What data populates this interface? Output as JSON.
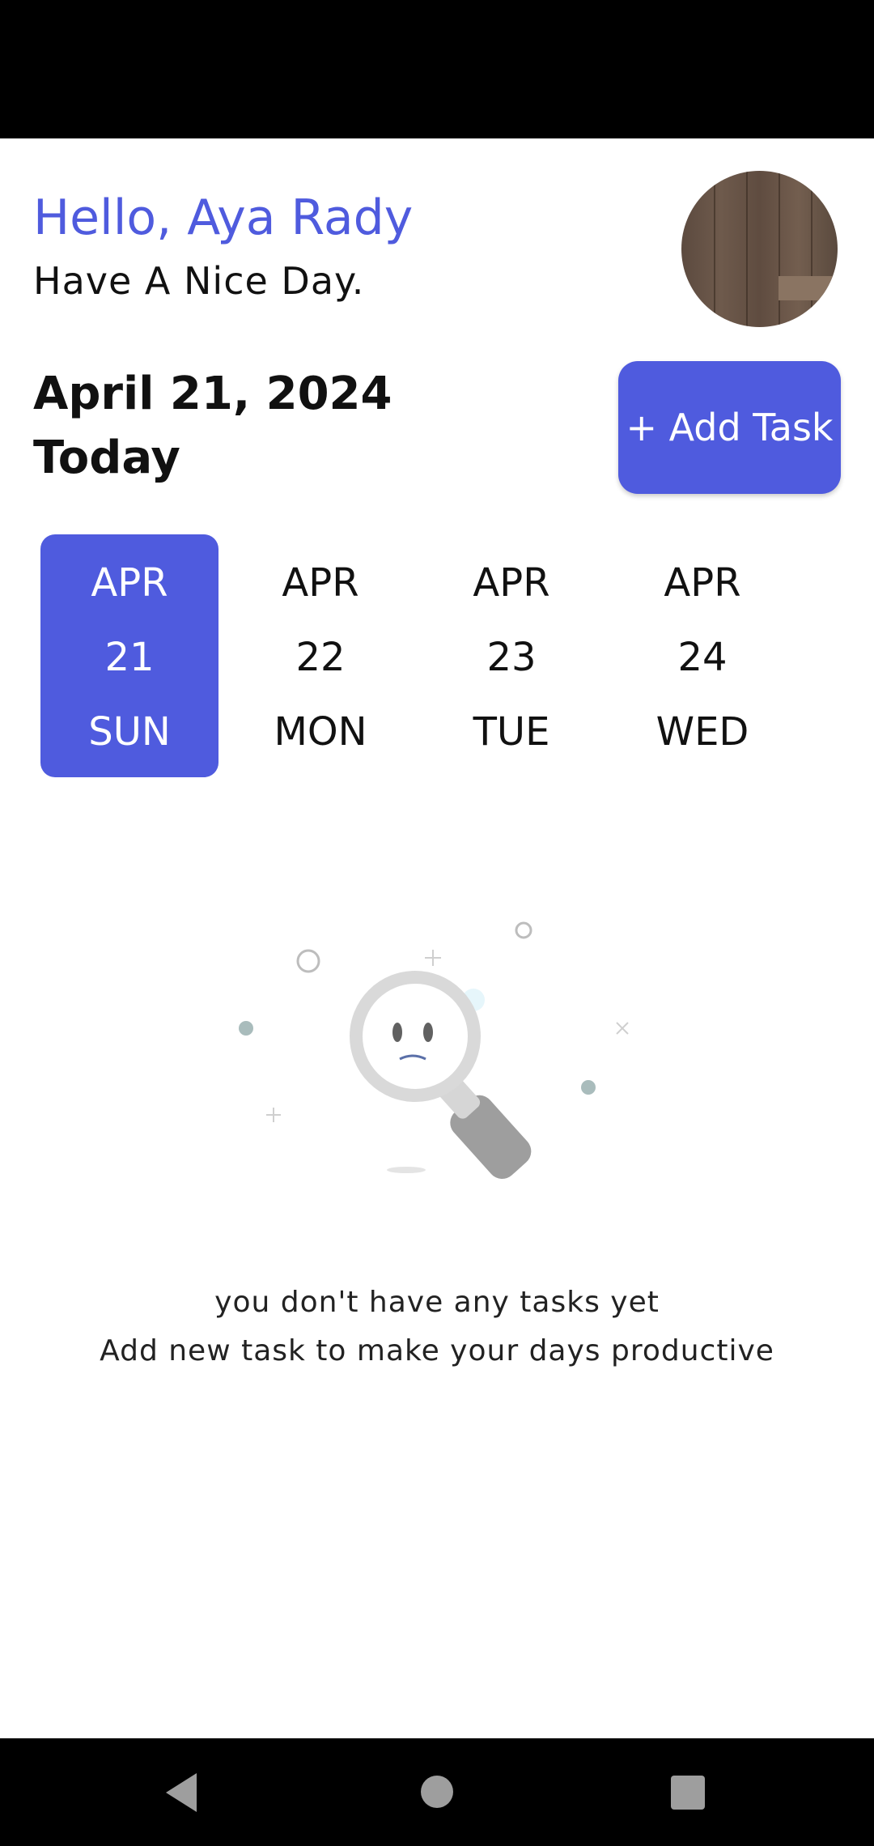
{
  "header": {
    "greeting": "Hello, Aya Rady",
    "subtitle": "Have A Nice Day.",
    "avatar_icon": "profile-photo"
  },
  "date_section": {
    "date": "April 21, 2024",
    "label": "Today",
    "add_task_label": "+ Add Task"
  },
  "calendar": {
    "days": [
      {
        "month": "APR",
        "day": "21",
        "weekday": "SUN",
        "selected": true
      },
      {
        "month": "APR",
        "day": "22",
        "weekday": "MON",
        "selected": false
      },
      {
        "month": "APR",
        "day": "23",
        "weekday": "TUE",
        "selected": false
      },
      {
        "month": "APR",
        "day": "24",
        "weekday": "WED",
        "selected": false
      }
    ]
  },
  "empty_state": {
    "illustration_icon": "sad-magnifier-icon",
    "line1": "you don't have any tasks yet",
    "line2": "Add new task to make your days productive"
  },
  "colors": {
    "accent": "#4f5bde",
    "text": "#111111",
    "background": "#ffffff"
  }
}
